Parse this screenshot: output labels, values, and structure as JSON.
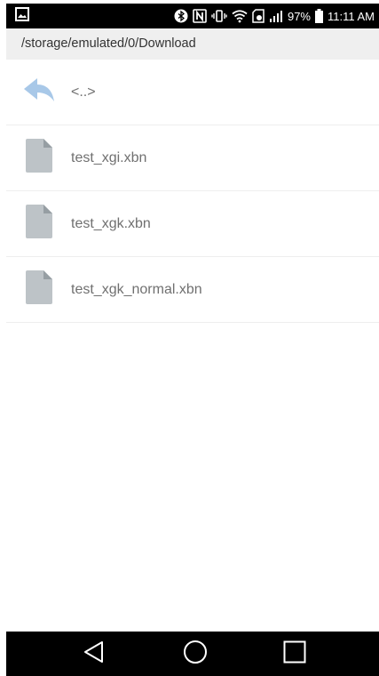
{
  "status_bar": {
    "battery_percent": "97%",
    "time": "11:11 AM",
    "icons": [
      "gallery-notification-icon",
      "bluetooth-icon",
      "nfc-icon",
      "vibrate-icon",
      "wifi-icon",
      "sd-card-icon",
      "signal-icon",
      "battery-icon"
    ]
  },
  "path": "/storage/emulated/0/Download",
  "files": [
    {
      "name": "<..>",
      "icon": "back-arrow-icon"
    },
    {
      "name": "test_xgi.xbn",
      "icon": "file-icon"
    },
    {
      "name": "test_xgk.xbn",
      "icon": "file-icon"
    },
    {
      "name": "test_xgk_normal.xbn",
      "icon": "file-icon"
    }
  ],
  "nav_bar": {
    "buttons": [
      "back-icon",
      "home-icon",
      "recents-icon"
    ]
  },
  "colors": {
    "status_bar_bg": "#000000",
    "path_bar_bg": "#efefef",
    "back_arrow": "#a8c8e8",
    "file_icon": "#bdc3c7",
    "label_text": "#707070"
  }
}
